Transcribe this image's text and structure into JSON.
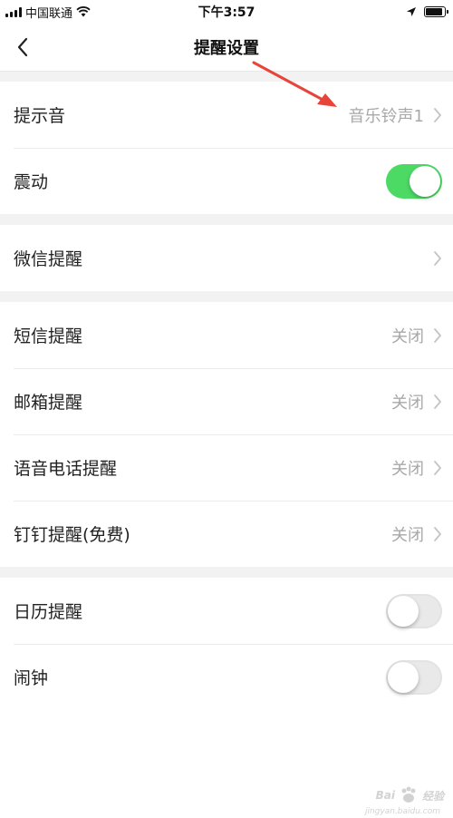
{
  "status_bar": {
    "carrier": "中国联通",
    "time": "下午3:57",
    "battery_level": 0.9
  },
  "nav": {
    "title": "提醒设置"
  },
  "sections": [
    {
      "rows": [
        {
          "label": "提示音",
          "value": "音乐铃声1",
          "type": "link"
        },
        {
          "label": "震动",
          "type": "toggle",
          "on": true
        }
      ]
    },
    {
      "rows": [
        {
          "label": "微信提醒",
          "value": "",
          "type": "link"
        }
      ]
    },
    {
      "rows": [
        {
          "label": "短信提醒",
          "value": "关闭",
          "type": "link"
        },
        {
          "label": "邮箱提醒",
          "value": "关闭",
          "type": "link"
        },
        {
          "label": "语音电话提醒",
          "value": "关闭",
          "type": "link"
        },
        {
          "label": "钉钉提醒(免费)",
          "value": "关闭",
          "type": "link"
        }
      ]
    },
    {
      "rows": [
        {
          "label": "日历提醒",
          "type": "toggle",
          "on": false
        },
        {
          "label": "闹钟",
          "type": "toggle",
          "on": false
        }
      ]
    }
  ],
  "watermark": {
    "brand": "Bai",
    "brand_cn": "经验",
    "url": "jingyan.baidu.com"
  },
  "colors": {
    "toggle_on": "#4cd964",
    "annotation_arrow": "#e8443a",
    "value_text": "#a8a8a8",
    "section_gap": "#f2f2f2"
  },
  "icons": {
    "back": "chevron-left-icon",
    "row_arrow": "chevron-right-icon",
    "wifi": "wifi-icon",
    "location": "location-arrow-icon",
    "battery": "battery-icon",
    "signal": "signal-bars-icon"
  }
}
